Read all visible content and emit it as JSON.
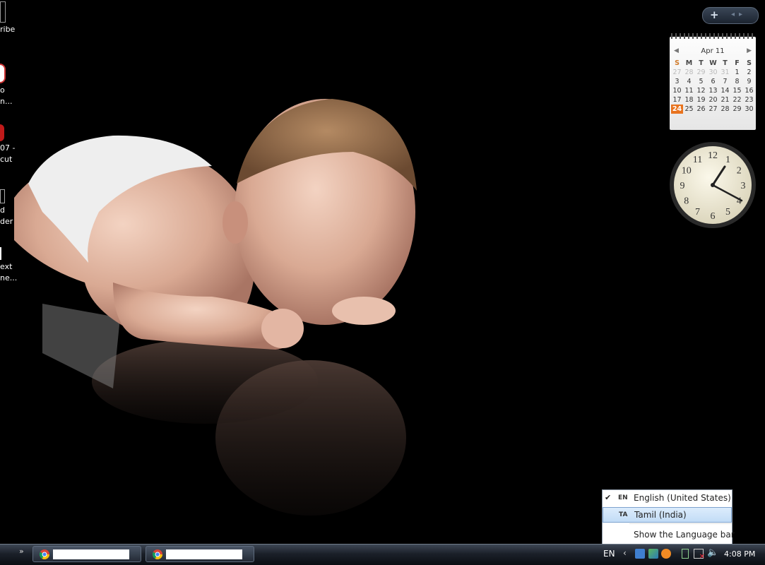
{
  "desktop": {
    "icons": [
      {
        "label": "ribe"
      },
      {
        "label": "o\nn..."
      },
      {
        "label": "07 -\ncut"
      },
      {
        "label": "d\nder"
      },
      {
        "label": "ext\nne..."
      }
    ]
  },
  "calendar": {
    "month_label": "Apr 11",
    "weekdays": [
      "S",
      "M",
      "T",
      "W",
      "T",
      "F",
      "S"
    ],
    "weeks": [
      [
        "27",
        "28",
        "29",
        "30",
        "31",
        "1",
        "2"
      ],
      [
        "3",
        "4",
        "5",
        "6",
        "7",
        "8",
        "9"
      ],
      [
        "10",
        "11",
        "12",
        "13",
        "14",
        "15",
        "16"
      ],
      [
        "17",
        "18",
        "19",
        "20",
        "21",
        "22",
        "23"
      ],
      [
        "24",
        "25",
        "26",
        "27",
        "28",
        "29",
        "30"
      ]
    ],
    "today": "24",
    "accent_color": "#e8731e"
  },
  "clock_gadget": {
    "numerals": [
      "12",
      "1",
      "2",
      "3",
      "4",
      "5",
      "6",
      "7",
      "8",
      "9",
      "10",
      "11"
    ]
  },
  "language_menu": {
    "items": [
      {
        "code": "EN",
        "label": "English (United States)",
        "checked": true
      },
      {
        "code": "TA",
        "label": "Tamil (India)",
        "checked": false
      }
    ],
    "show_bar_label": "Show the Language bar"
  },
  "taskbar": {
    "chevron": "»",
    "language_indicator": "EN",
    "tray_arrow": "‹",
    "time": "4:08 PM",
    "tasks": [
      {
        "icon": "chrome-icon"
      },
      {
        "icon": "chrome-icon"
      }
    ]
  }
}
